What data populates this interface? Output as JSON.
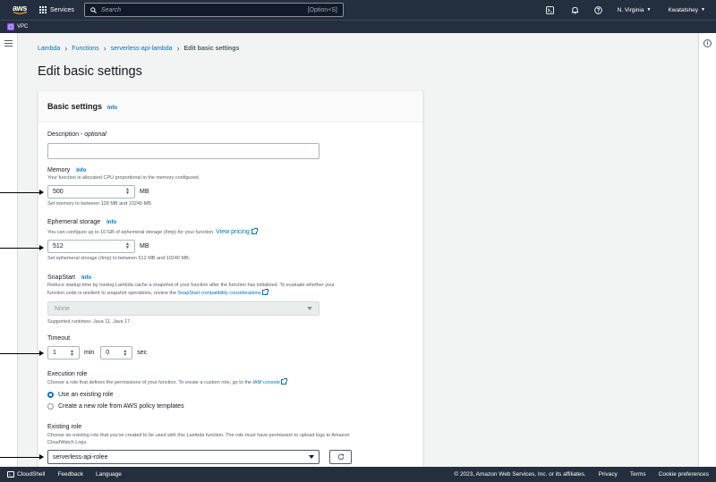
{
  "nav": {
    "logo_text": "aws",
    "services_label": "Services",
    "search_placeholder": "Search",
    "search_shortcut": "[Option+S]",
    "region": "N. Virginia",
    "account": "Kwatatshey"
  },
  "subbar": {
    "service_label": "VPC"
  },
  "breadcrumb": {
    "items": [
      "Lambda",
      "Functions",
      "serverless-api-lambda"
    ],
    "current": "Edit basic settings"
  },
  "page_title": "Edit basic settings",
  "card": {
    "title": "Basic settings",
    "info": "Info",
    "description": {
      "label": "Description",
      "optional": "- optional",
      "value": ""
    },
    "memory": {
      "label": "Memory",
      "info": "Info",
      "desc": "Your function is allocated CPU proportional to the memory configured.",
      "value": "500",
      "unit": "MB",
      "hint": "Set memory to between 128 MB and 10240 MB"
    },
    "ephemeral": {
      "label": "Ephemeral storage",
      "info": "Info",
      "desc": "You can configure up to 10 GB of ephemeral storage (/tmp) for your function.",
      "link": "View pricing",
      "value": "512",
      "unit": "MB",
      "hint": "Set ephemeral storage (/tmp) to between 512 MB and 10240 MB."
    },
    "snapstart": {
      "label": "SnapStart",
      "info": "Info",
      "desc1": "Reduce startup time by having Lambda cache a snapshot of your function after the function has initialized. To evaluate whether your",
      "desc2": "function code is resilient to snapshot operations, review the",
      "link": "SnapStart compatibility considerations",
      "desc_end": ".",
      "value": "None",
      "hint": "Supported runtimes: Java 11, Java 17."
    },
    "timeout": {
      "label": "Timeout",
      "min_value": "1",
      "min_unit": "min",
      "sec_value": "0",
      "sec_unit": "sec"
    },
    "execution_role": {
      "label": "Execution role",
      "desc": "Choose a role that defines the permissions of your function. To create a custom role, go to the",
      "link": "IAM console",
      "desc_end": ".",
      "options": [
        "Use an existing role",
        "Create a new role from AWS policy templates"
      ],
      "selected": "Use an existing role"
    },
    "existing_role": {
      "label": "Existing role",
      "desc1": "Choose an existing role that you've created to be used with this Lambda function. The role must have permission to upload logs to Amazon",
      "desc2": "CloudWatch Logs.",
      "value": "serverless-api-rolee"
    }
  },
  "footer": {
    "cloudshell": "CloudShell",
    "feedback": "Feedback",
    "language": "Language",
    "copyright": "© 2023, Amazon Web Services, Inc. or its affiliates.",
    "privacy": "Privacy",
    "terms": "Terms",
    "cookie": "Cookie preferences"
  }
}
